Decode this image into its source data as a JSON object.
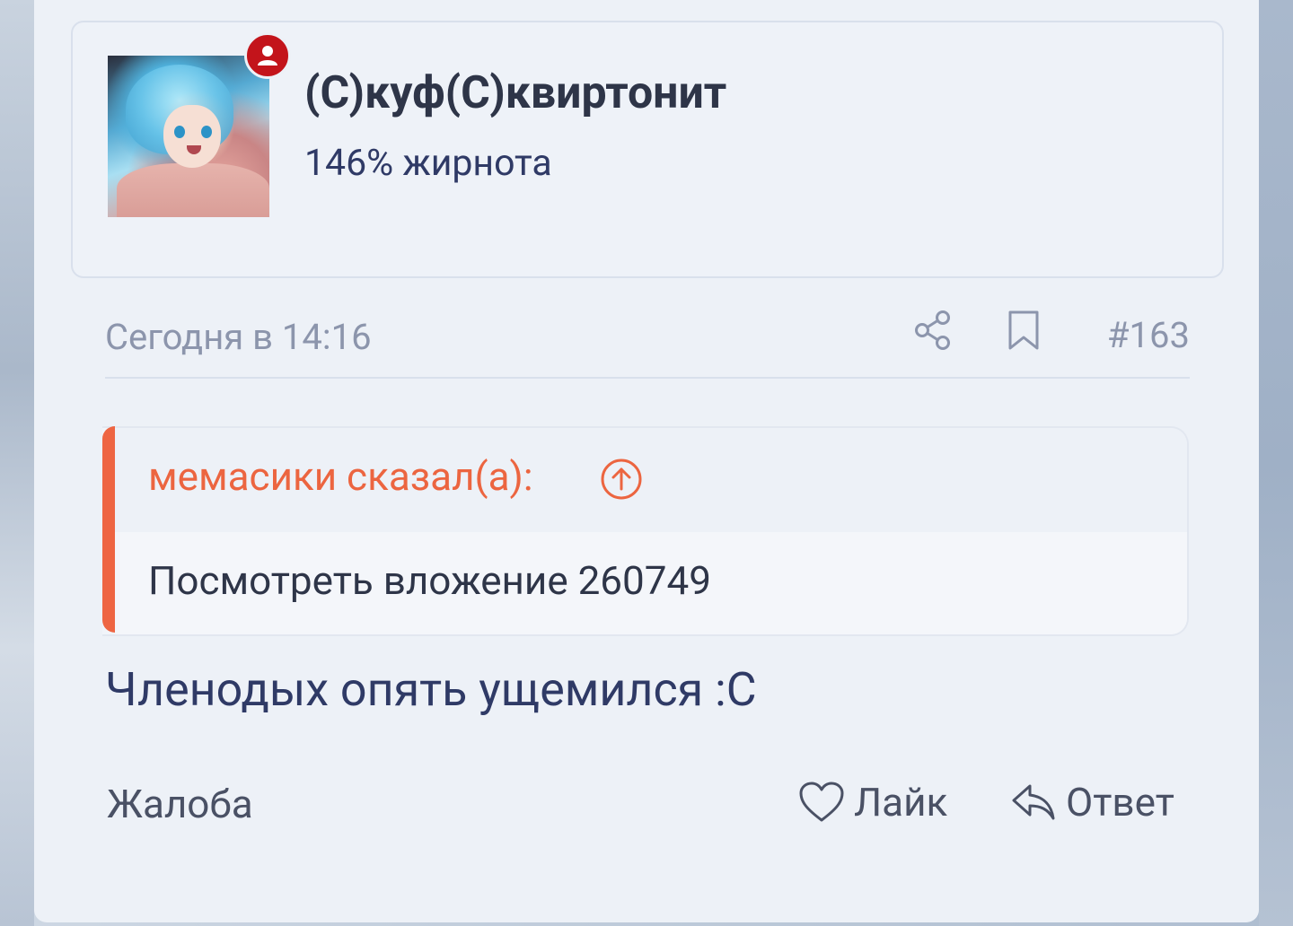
{
  "user": {
    "name": "(С)куф(С)квиртонит",
    "title": "146% жирнота",
    "status_badge_icon": "person-icon",
    "status_badge_color": "#c3141b"
  },
  "post": {
    "date": "Сегодня в 14:16",
    "number": "#163",
    "text": "Членодых опять ущемился :С"
  },
  "quote": {
    "author": "мемасики сказал(а):",
    "text": "Посмотреть вложение 260749",
    "accent_color": "#ee6542"
  },
  "actions": {
    "report": "Жалоба",
    "like": "Лайк",
    "reply": "Ответ"
  },
  "icons": {
    "share": "share-icon",
    "bookmark": "bookmark-icon",
    "go_to_quote": "arrow-up-circle-icon",
    "like": "heart-icon",
    "reply": "reply-icon"
  }
}
